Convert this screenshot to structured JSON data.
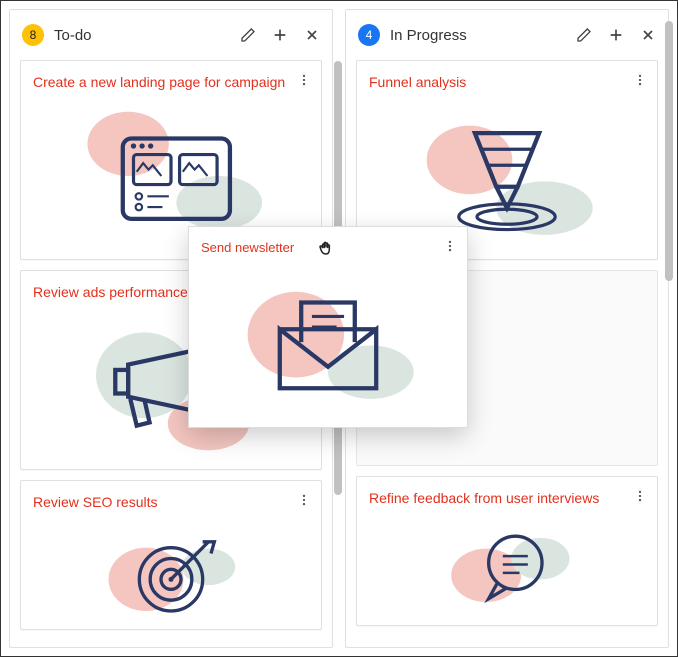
{
  "columns": [
    {
      "badgeColor": "yellow",
      "count": "8",
      "title": "To-do",
      "cards": [
        {
          "title": "Create a new landing page for campaign",
          "illus": "wireframe"
        },
        {
          "title": "Review ads performance",
          "illus": "megaphone"
        },
        {
          "title": "Review SEO results",
          "illus": "target"
        }
      ]
    },
    {
      "badgeColor": "blue",
      "count": "4",
      "title": "In Progress",
      "cards": [
        {
          "title": "Funnel analysis",
          "illus": "funnel"
        },
        {
          "placeholder": true
        },
        {
          "title": "Refine feedback from user interviews",
          "illus": "chat"
        }
      ]
    }
  ],
  "draggedCard": {
    "title": "Send newsletter"
  }
}
